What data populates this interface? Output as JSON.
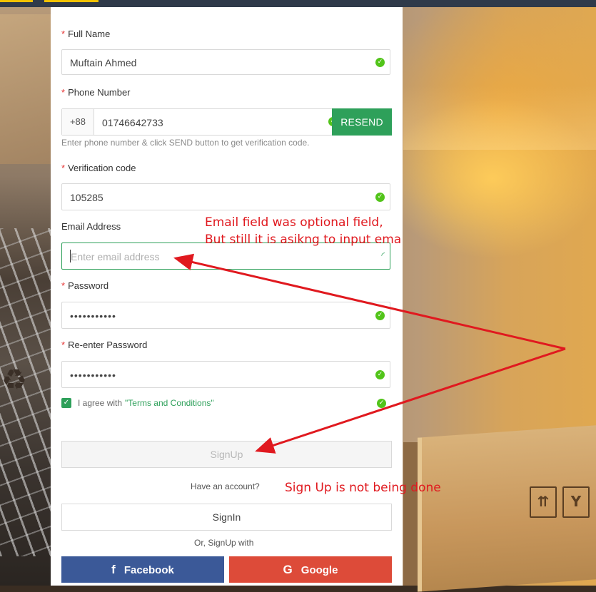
{
  "form": {
    "full_name": {
      "label": "Full Name",
      "value": "Muftain Ahmed"
    },
    "phone": {
      "label": "Phone Number",
      "prefix": "+88",
      "value": "01746642733",
      "resend_label": "RESEND",
      "hint": "Enter phone number & click SEND button to get verification code."
    },
    "verification": {
      "label": "Verification code",
      "value": "105285"
    },
    "email": {
      "label": "Email Address",
      "placeholder": "Enter email address"
    },
    "password": {
      "label": "Password",
      "value": "•••••••••••"
    },
    "reenter_password": {
      "label": "Re-enter Password",
      "value": "•••••••••••"
    },
    "agree": {
      "text": "I agree with",
      "terms_link": "\"Terms and Conditions\""
    },
    "signup_label": "SignUp",
    "have_account": "Have an account?",
    "signin_label": "SignIn",
    "or_signup_with": "Or, SignUp with",
    "facebook_label": "Facebook",
    "google_label": "Google"
  },
  "annotations": {
    "email_note_line1": "Email field was optional field,",
    "email_note_line2": "But still it is asikng to input email",
    "signup_note": "Sign Up is not being done"
  },
  "colors": {
    "accent_green": "#2ea05a",
    "required_red": "#e63434",
    "facebook_blue": "#3b5998",
    "google_red": "#dd4b39",
    "annotation_red": "#e0191f"
  }
}
